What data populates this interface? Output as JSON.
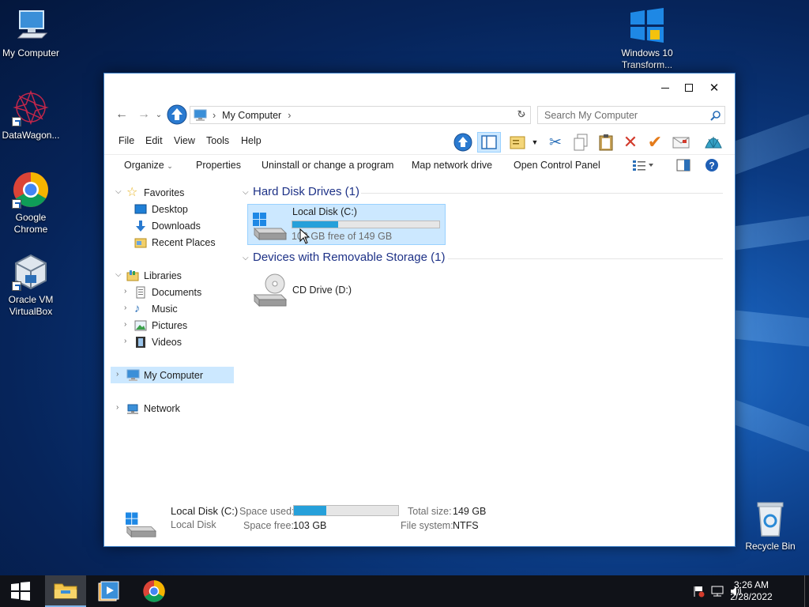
{
  "desktop": {
    "icons": [
      {
        "label": "My Computer"
      },
      {
        "label": "DataWagon..."
      },
      {
        "label": "Google Chrome"
      },
      {
        "label": "Oracle VM VirtualBox"
      },
      {
        "label": "Windows 10 Transform..."
      },
      {
        "label": "Recycle Bin"
      }
    ]
  },
  "window": {
    "address": {
      "crumb": "My Computer"
    },
    "search": {
      "placeholder": "Search My Computer"
    },
    "menu": [
      "File",
      "Edit",
      "View",
      "Tools",
      "Help"
    ],
    "commands": [
      "Organize",
      "Properties",
      "Uninstall or change a program",
      "Map network drive",
      "Open Control Panel"
    ],
    "nav": {
      "favorites": "Favorites",
      "favorite_items": [
        "Desktop",
        "Downloads",
        "Recent Places"
      ],
      "libraries": "Libraries",
      "library_items": [
        "Documents",
        "Music",
        "Pictures",
        "Videos"
      ],
      "my_computer": "My Computer",
      "network": "Network"
    },
    "groups": {
      "hdd": "Hard Disk Drives (1)",
      "removable": "Devices with Removable Storage (1)"
    },
    "drives": {
      "c": {
        "name": "Local Disk (C:)",
        "free_text": "103 GB free of 149 GB",
        "used_fraction": 0.31
      },
      "d": {
        "name": "CD Drive (D:)"
      }
    },
    "details": {
      "name": "Local Disk (C:)",
      "type": "Local Disk",
      "space_used_label": "Space used:",
      "space_free_label": "Space free:",
      "space_free": "103 GB",
      "total_size_label": "Total size:",
      "total_size": "149 GB",
      "file_system_label": "File system:",
      "file_system": "NTFS",
      "used_fraction": 0.31
    }
  },
  "taskbar": {
    "time": "3:26 AM",
    "date": "2/28/2022"
  },
  "colors": {
    "accent": "#26a0da",
    "selection": "#cce8ff",
    "group_heading": "#1e3287"
  }
}
